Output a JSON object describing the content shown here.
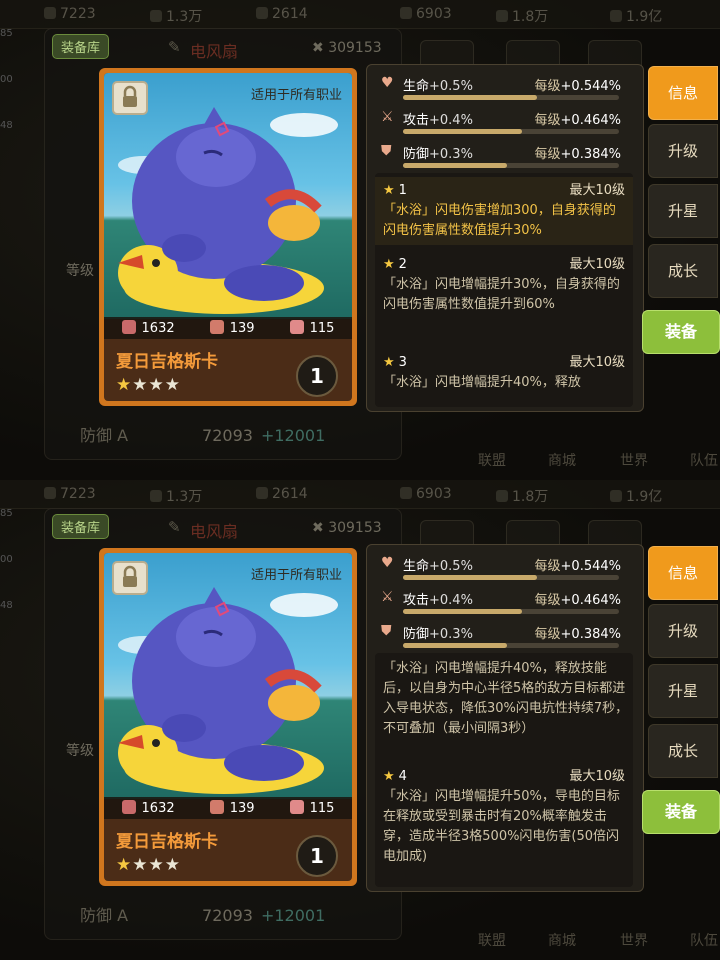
{
  "resources": [
    "7223",
    "1.3万",
    "2614",
    "6903",
    "1.8万",
    "1.9亿"
  ],
  "sidebar_nums": [
    "85",
    "00",
    "48"
  ],
  "background": {
    "library_label": "装备库",
    "hero_name": "电风扇",
    "power": "309153",
    "level_label": "等级",
    "defense_label": "防御 A",
    "defense_value": "72093",
    "defense_bonus": "+12001",
    "bottom_tabs": [
      "联盟",
      "商城",
      "世界",
      "队伍"
    ]
  },
  "card": {
    "scope_text": "适用于所有职业",
    "name": "夏日吉格斯卡",
    "stars_filled": 1,
    "stars_total": 4,
    "level": "1",
    "stats": {
      "hp": "1632",
      "atk": "139",
      "def": "115"
    }
  },
  "stat_rows": [
    {
      "icon": "heart-icon",
      "name": "生命",
      "value": "+0.5%",
      "per_label": "每级",
      "per_value": "+0.544%",
      "fill": 0.62
    },
    {
      "icon": "sword-icon",
      "name": "攻击",
      "value": "+0.4%",
      "per_label": "每级",
      "per_value": "+0.464%",
      "fill": 0.55
    },
    {
      "icon": "shield-icon",
      "name": "防御",
      "value": "+0.3%",
      "per_label": "每级",
      "per_value": "+0.384%",
      "fill": 0.48
    }
  ],
  "panel1_skills": [
    {
      "star": "★",
      "level": "1",
      "max": "最大10级",
      "text": "「水浴」闪电伤害增加300，自身获得的闪电伤害属性数值提升30%",
      "highlight": true
    },
    {
      "star": "★",
      "level": "2",
      "max": "最大10级",
      "text": "「水浴」闪电增幅提升30%，自身获得的闪电伤害属性数值提升到60%",
      "highlight": false
    },
    {
      "star": "★",
      "level": "3",
      "max": "最大10级",
      "text": "「水浴」闪电增幅提升40%，释放",
      "highlight": false
    }
  ],
  "panel2_continued": "「水浴」闪电增幅提升40%，释放技能后，以自身为中心半径5格的敌方目标都进入导电状态，降低30%闪电抗性持续7秒，不可叠加（最小间隔3秒）",
  "panel2_skill4": {
    "star": "★",
    "level": "4",
    "max": "最大10级",
    "text": "「水浴」闪电增幅提升50%，导电的目标在释放或受到暴击时有20%概率触发击穿，造成半径3格500%闪电伤害(50倍闪电加成)"
  },
  "tabs": [
    "信息",
    "升级",
    "升星",
    "成长"
  ],
  "equip_label": "装备",
  "colors": {
    "accent": "#f09a1c",
    "equip": "#8dbf3b",
    "card_border": "#d0761e",
    "skill_highlight": "#f2c247"
  }
}
